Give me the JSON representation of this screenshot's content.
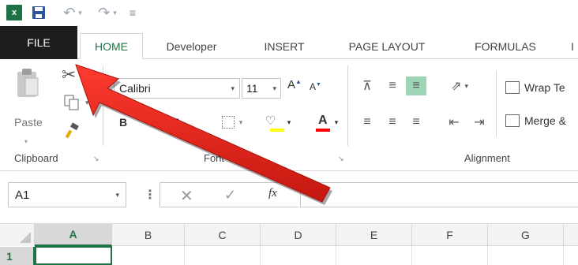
{
  "quick_access": {
    "app_logo": "x",
    "save_icon": "save-icon",
    "undo_icon": "undo-icon",
    "redo_icon": "redo-icon",
    "customize_icon": "customize-qat-icon"
  },
  "tabs": [
    {
      "label": "FILE"
    },
    {
      "label": "HOME"
    },
    {
      "label": "Developer"
    },
    {
      "label": "INSERT"
    },
    {
      "label": "PAGE LAYOUT"
    },
    {
      "label": "FORMULAS"
    },
    {
      "label": "I"
    }
  ],
  "clipboard": {
    "paste_label": "Paste",
    "group_label": "Clipboard"
  },
  "font": {
    "name": "Calibri",
    "size": "11",
    "bold": "B",
    "italic": "I",
    "underline": "U",
    "group_label": "Font",
    "fill_color": "#ffff00",
    "font_color": "#ff0000"
  },
  "alignment": {
    "wrap_text": "Wrap Te",
    "merge": "Merge &",
    "group_label": "Alignment"
  },
  "formula_bar": {
    "name_box": "A1",
    "fx": "fx",
    "formula": ""
  },
  "grid": {
    "columns": [
      "A",
      "B",
      "C",
      "D",
      "E",
      "F",
      "G"
    ],
    "rows": [
      "1"
    ],
    "selected_cell": "A1"
  },
  "annotation": {
    "arrow_color": "#e2231a",
    "points_to": "FILE"
  },
  "colors": {
    "accent": "#217346",
    "file_tab_bg": "#1d1d1d"
  }
}
